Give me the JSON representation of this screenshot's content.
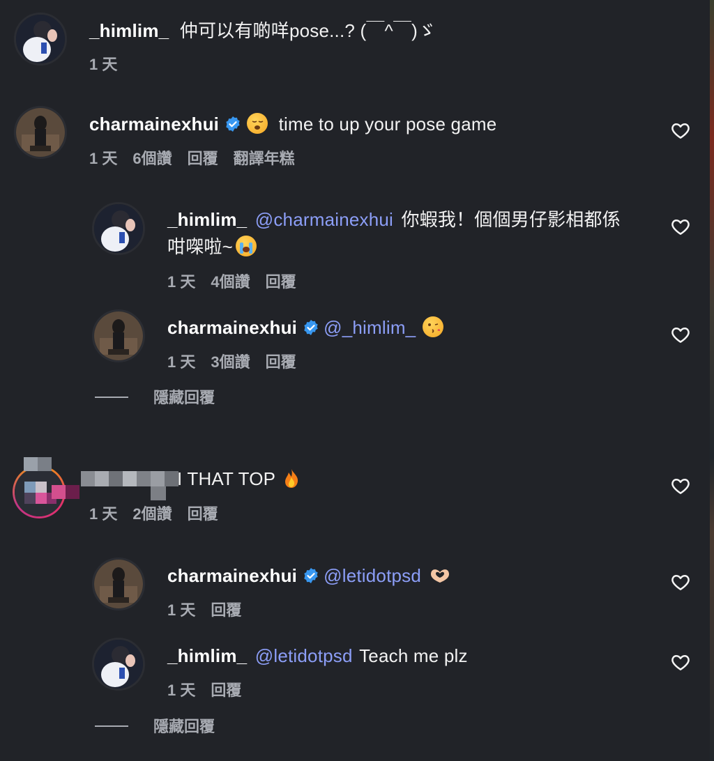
{
  "colors": {
    "background": "#212328",
    "mention": "#8c9ef7",
    "meta": "#a8abb2",
    "verified": "#3897f0"
  },
  "comments": [
    {
      "username": "_himlim_",
      "text": "仲可以有啲咩pose...? (￣^￣)ゞ",
      "time": "1 天"
    },
    {
      "username": "charmainexhui",
      "verified": true,
      "emoji": "sleepy-face-emoji",
      "text": "time to up your pose game",
      "time": "1 天",
      "likes": "6個讚",
      "reply_label": "回覆",
      "translate_label": "翻譯年糕",
      "replies": [
        {
          "username": "_himlim_",
          "mention": "@charmainexhui",
          "text_line1": "你蝦我！個個男仔影相都係",
          "text_line2": "咁㗎啦~",
          "emoji": "crying-face-emoji",
          "time": "1 天",
          "likes": "4個讚",
          "reply_label": "回覆"
        },
        {
          "username": "charmainexhui",
          "verified": true,
          "mention": "@_himlim_",
          "emoji": "kissing-face-emoji",
          "time": "1 天",
          "likes": "3個讚",
          "reply_label": "回覆"
        }
      ],
      "hide_replies_label": "隱藏回覆"
    },
    {
      "username_hidden": true,
      "text": "I THAT TOP",
      "emoji": "fire-emoji",
      "time": "1 天",
      "likes": "2個讚",
      "reply_label": "回覆",
      "replies": [
        {
          "username": "charmainexhui",
          "verified": true,
          "mention": "@letidotpsd",
          "emoji": "heart-hands-emoji",
          "time": "1 天",
          "reply_label": "回覆"
        },
        {
          "username": "_himlim_",
          "mention": "@letidotpsd",
          "text": "Teach me plz",
          "time": "1 天",
          "reply_label": "回覆"
        }
      ],
      "hide_replies_label": "隱藏回覆"
    }
  ],
  "icons": {
    "like": "heart-outline-icon",
    "verified": "verified-badge-icon"
  }
}
